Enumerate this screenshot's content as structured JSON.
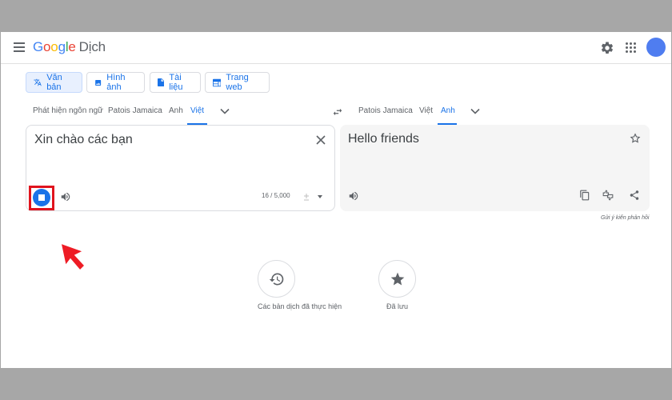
{
  "app": {
    "logo_google": [
      "G",
      "o",
      "o",
      "g",
      "l",
      "e"
    ],
    "logo_dich": "Dịch"
  },
  "modes": [
    {
      "label": "Văn bản",
      "icon": "translate-icon",
      "active": true
    },
    {
      "label": "Hình ảnh",
      "icon": "image-icon",
      "active": false
    },
    {
      "label": "Tài liệu",
      "icon": "document-icon",
      "active": false
    },
    {
      "label": "Trang web",
      "icon": "web-icon",
      "active": false
    }
  ],
  "source_langs": [
    {
      "label": "Phát hiện ngôn ngữ",
      "active": false
    },
    {
      "label": "Patois Jamaica",
      "active": false
    },
    {
      "label": "Anh",
      "active": false
    },
    {
      "label": "Việt",
      "active": true
    }
  ],
  "target_langs": [
    {
      "label": "Patois Jamaica",
      "active": false
    },
    {
      "label": "Việt",
      "active": false
    },
    {
      "label": "Anh",
      "active": true
    }
  ],
  "source": {
    "text": "Xin chào các bạn",
    "char_count": "16 / 5,000"
  },
  "target": {
    "text": "Hello friends"
  },
  "feedback": "Gửi ý kiến phản hồi",
  "history": {
    "label": "Các bản dịch đã thực hiện",
    "icon": "history-icon"
  },
  "saved": {
    "label": "Đã lưu",
    "icon": "star-icon"
  },
  "colors": {
    "accent": "#1a73e8",
    "highlight": "#e0141e",
    "arrow": "#ee1c25"
  }
}
